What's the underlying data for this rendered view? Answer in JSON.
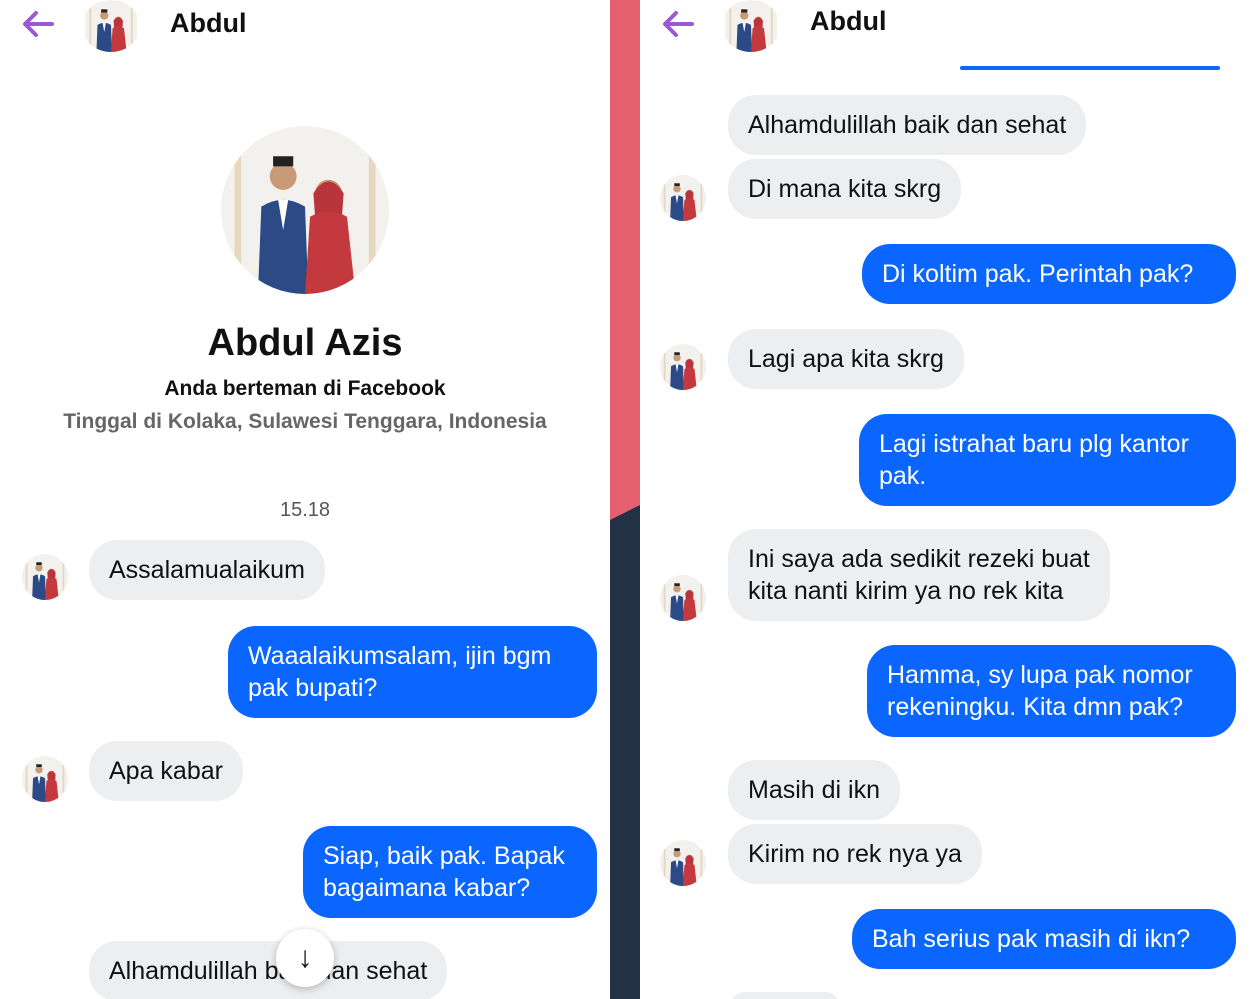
{
  "colors": {
    "back_arrow": "#9b59d6",
    "incoming_bubble": "#eceef0",
    "outgoing_bubble": "#0a66ff",
    "divider_pink": "#e5606f",
    "divider_navy": "#243246"
  },
  "left": {
    "header": {
      "back_icon": "arrow-left-icon",
      "name": "Abdul"
    },
    "profile": {
      "full_name": "Abdul Azis",
      "friend_status": "Anda berteman di Facebook",
      "location": "Tinggal di Kolaka, Sulawesi Tenggara, Indonesia"
    },
    "timestamp": "15.18",
    "messages": [
      {
        "dir": "in",
        "text": "Assalamualaikum"
      },
      {
        "dir": "out",
        "text": "Waaalaikumsalam, ijin bgm\npak bupati?"
      },
      {
        "dir": "in",
        "text": "Apa kabar"
      },
      {
        "dir": "out",
        "text": "Siap, baik pak. Bapak\nbagaimana kabar?"
      },
      {
        "dir": "in",
        "text": "Alhamdulillah baik dan sehat"
      }
    ],
    "scroll_down_icon": "↓"
  },
  "right": {
    "header": {
      "back_icon": "arrow-left-icon",
      "name": "Abdul"
    },
    "messages": [
      {
        "dir": "in",
        "text": "Alhamdulillah baik dan sehat"
      },
      {
        "dir": "in",
        "text": "Di mana kita skrg"
      },
      {
        "dir": "out",
        "text": "Di koltim pak. Perintah pak?"
      },
      {
        "dir": "in",
        "text": "Lagi apa kita skrg"
      },
      {
        "dir": "out",
        "text": "Lagi istrahat baru plg kantor\npak."
      },
      {
        "dir": "in",
        "text": "Ini saya ada sedikit rezeki buat\nkita nanti kirim ya no rek kita"
      },
      {
        "dir": "out",
        "text": "Hamma, sy lupa pak nomor\nrekeningku. Kita dmn pak?"
      },
      {
        "dir": "in",
        "text": "Masih di ikn"
      },
      {
        "dir": "in",
        "text": "Kirim no rek nya ya"
      },
      {
        "dir": "out",
        "text": "Bah serius pak masih di ikn?"
      }
    ]
  }
}
